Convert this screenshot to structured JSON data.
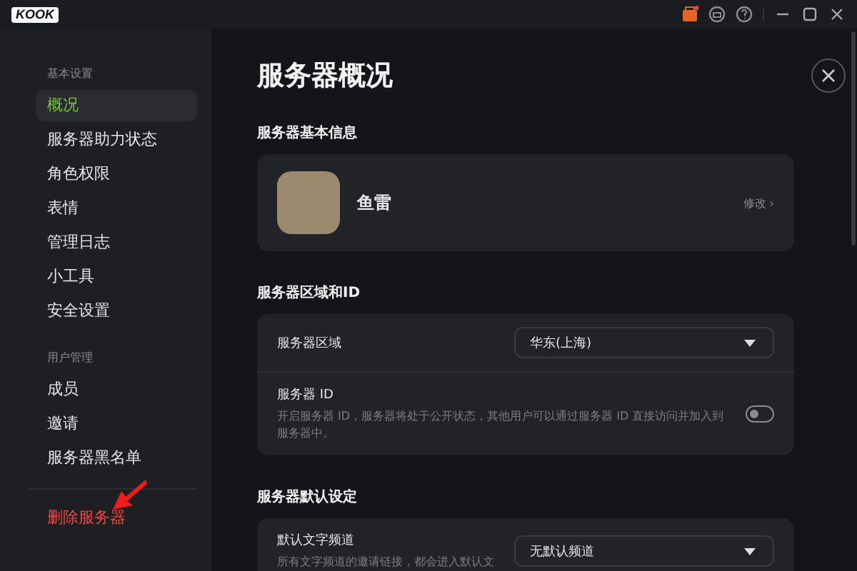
{
  "app": {
    "logo": "KOOK"
  },
  "sidebar": {
    "groups": [
      {
        "heading": "基本设置",
        "items": [
          {
            "label": "概况",
            "selected": true
          },
          {
            "label": "服务器助力状态",
            "selected": false
          },
          {
            "label": "角色权限",
            "selected": false
          },
          {
            "label": "表情",
            "selected": false
          },
          {
            "label": "管理日志",
            "selected": false
          },
          {
            "label": "小工具",
            "selected": false
          },
          {
            "label": "安全设置",
            "selected": false
          }
        ]
      },
      {
        "heading": "用户管理",
        "items": [
          {
            "label": "成员",
            "selected": false
          },
          {
            "label": "邀请",
            "selected": false
          },
          {
            "label": "服务器黑名单",
            "selected": false
          }
        ]
      }
    ],
    "danger_item": "删除服务器"
  },
  "page": {
    "title": "服务器概况",
    "sections": [
      {
        "heading": "服务器基本信息",
        "kind": "profile",
        "name": "鱼雷",
        "edit_link": "修改 ›"
      },
      {
        "heading": "服务器区域和ID",
        "kind": "rows",
        "rows": [
          {
            "kind": "select",
            "label": "服务器区域",
            "value": "华东(上海)"
          },
          {
            "kind": "toggle",
            "label": "服务器 ID",
            "description": "开启服务器 ID，服务器将处于公开状态，其他用户可以通过服务器 ID 直接访问并加入到服务器中。",
            "on": false
          }
        ]
      },
      {
        "heading": "服务器默认设定",
        "kind": "rows",
        "rows": [
          {
            "kind": "select",
            "label": "默认文字频道",
            "description": "所有文字频道的邀请链接，都会进入默认文",
            "value": "无默认频道"
          }
        ]
      }
    ]
  }
}
